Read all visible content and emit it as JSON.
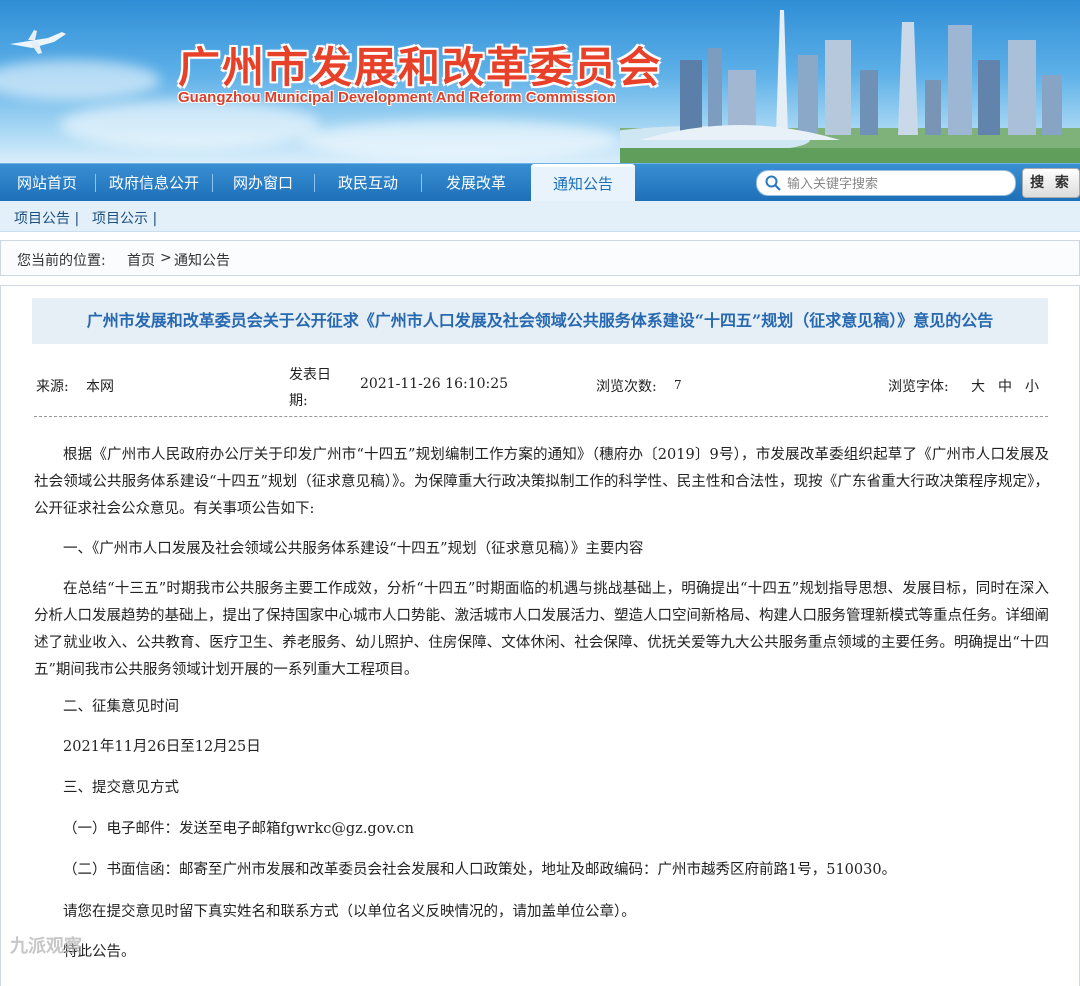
{
  "banner": {
    "title_cn": "广州市发展和改革委员会",
    "title_en": "Guangzhou Municipal Development And Reform Commission"
  },
  "nav": {
    "items": [
      {
        "label": "网站首页"
      },
      {
        "label": "政府信息公开"
      },
      {
        "label": "网办窗口"
      },
      {
        "label": "政民互动"
      },
      {
        "label": "发展改革"
      },
      {
        "label": "通知公告",
        "active": true
      }
    ]
  },
  "search": {
    "placeholder": "输入关键字搜索",
    "button_label": "搜 索"
  },
  "subnav": {
    "items": [
      "项目公告 |",
      "项目公示 |"
    ]
  },
  "breadcrumb": {
    "prefix": "您当前的位置:",
    "home": "首页",
    "sep": ">",
    "current": "通知公告"
  },
  "article": {
    "title": "广州市发展和改革委员会关于公开征求《广州市人口发展及社会领域公共服务体系建设“十四五”规划（征求意见稿）》意见的公告",
    "meta": {
      "source_label": "来源:",
      "source_value": "本网",
      "date_label_1": "发表日",
      "date_label_2": "期:",
      "date_value": "2021-11-26 16:10:25",
      "views_label": "浏览次数:",
      "views_value": "7",
      "font_label": "浏览字体:",
      "font_large": "大",
      "font_medium": "中",
      "font_small": "小"
    },
    "paragraphs": [
      "根据《广州市人民政府办公厅关于印发广州市“十四五”规划编制工作方案的通知》（穗府办〔2019〕9号），市发展改革委组织起草了《广州市人口发展及社会领域公共服务体系建设“十四五”规划（征求意见稿）》。为保障重大行政决策拟制工作的科学性、民主性和合法性，现按《广东省重大行政决策程序规定》，公开征求社会公众意见。有关事项公告如下:",
      "一、《广州市人口发展及社会领域公共服务体系建设“十四五”规划（征求意见稿）》主要内容",
      "在总结“十三五”时期我市公共服务主要工作成效，分析“十四五”时期面临的机遇与挑战基础上，明确提出“十四五”规划指导思想、发展目标，同时在深入分析人口发展趋势的基础上，提出了保持国家中心城市人口势能、激活城市人口发展活力、塑造人口空间新格局、构建人口服务管理新模式等重点任务。详细阐述了就业收入、公共教育、医疗卫生、养老服务、幼儿照护、住房保障、文体休闲、社会保障、优抚关爱等九大公共服务重点领域的主要任务。明确提出“十四五”期间我市公共服务领域计划开展的一系列重大工程项目。",
      "二、征集意见时间",
      "2021年11月26日至12月25日",
      "三、提交意见方式",
      "（一）电子邮件：发送至电子邮箱fgwrkc@gz.gov.cn",
      "（二）书面信函：邮寄至广州市发展和改革委员会社会发展和人口政策处，地址及邮政编码：广州市越秀区府前路1号，510030。",
      "请您在提交意见时留下真实姓名和联系方式（以单位名义反映情况的，请加盖单位公章）。",
      "特此公告。"
    ]
  },
  "watermark": "九派观察"
}
